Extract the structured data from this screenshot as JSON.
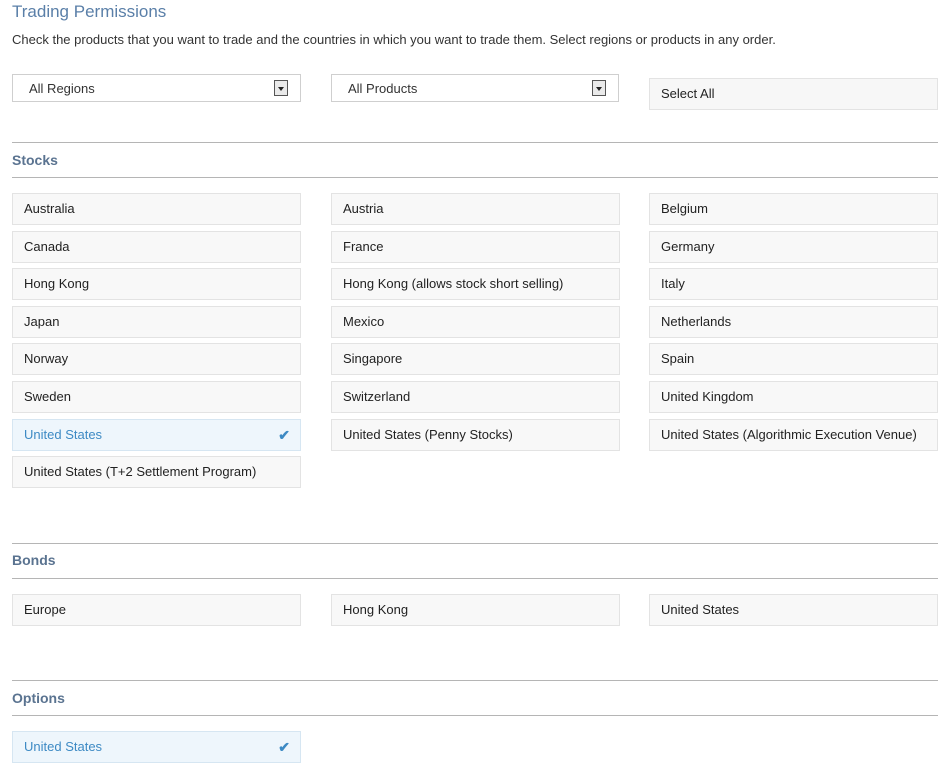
{
  "header": {
    "title": "Trading Permissions",
    "subtitle": "Check the products that you want to trade and the countries in which you want to trade them. Select regions or products in any order."
  },
  "filters": {
    "regions": "All Regions",
    "products": "All Products",
    "select_all": "Select All"
  },
  "sections": {
    "stocks": {
      "title": "Stocks",
      "items": [
        {
          "label": "Australia",
          "checked": false
        },
        {
          "label": "Austria",
          "checked": false
        },
        {
          "label": "Belgium",
          "checked": false
        },
        {
          "label": "Canada",
          "checked": false
        },
        {
          "label": "France",
          "checked": false
        },
        {
          "label": "Germany",
          "checked": false
        },
        {
          "label": "Hong Kong",
          "checked": false
        },
        {
          "label": "Hong Kong (allows stock short selling)",
          "checked": false
        },
        {
          "label": "Italy",
          "checked": false
        },
        {
          "label": "Japan",
          "checked": false
        },
        {
          "label": "Mexico",
          "checked": false
        },
        {
          "label": "Netherlands",
          "checked": false
        },
        {
          "label": "Norway",
          "checked": false
        },
        {
          "label": "Singapore",
          "checked": false
        },
        {
          "label": "Spain",
          "checked": false
        },
        {
          "label": "Sweden",
          "checked": false
        },
        {
          "label": "Switzerland",
          "checked": false
        },
        {
          "label": "United Kingdom",
          "checked": false
        },
        {
          "label": "United States",
          "checked": true
        },
        {
          "label": "United States (Penny Stocks)",
          "checked": false
        },
        {
          "label": "United States (Algorithmic Execution Venue)",
          "checked": false
        },
        {
          "label": "United States (T+2 Settlement Program)",
          "checked": false
        }
      ]
    },
    "bonds": {
      "title": "Bonds",
      "items": [
        {
          "label": "Europe",
          "checked": false
        },
        {
          "label": "Hong Kong",
          "checked": false
        },
        {
          "label": "United States",
          "checked": false
        }
      ]
    },
    "options": {
      "title": "Options",
      "items": [
        {
          "label": "United States",
          "checked": true
        }
      ]
    }
  },
  "icons": {
    "check": "checkmark-icon",
    "dropdown": "chevron-down-icon"
  },
  "colors": {
    "accent": "#3d8ac4",
    "title": "#5a7fa8",
    "section": "#5a7390"
  }
}
